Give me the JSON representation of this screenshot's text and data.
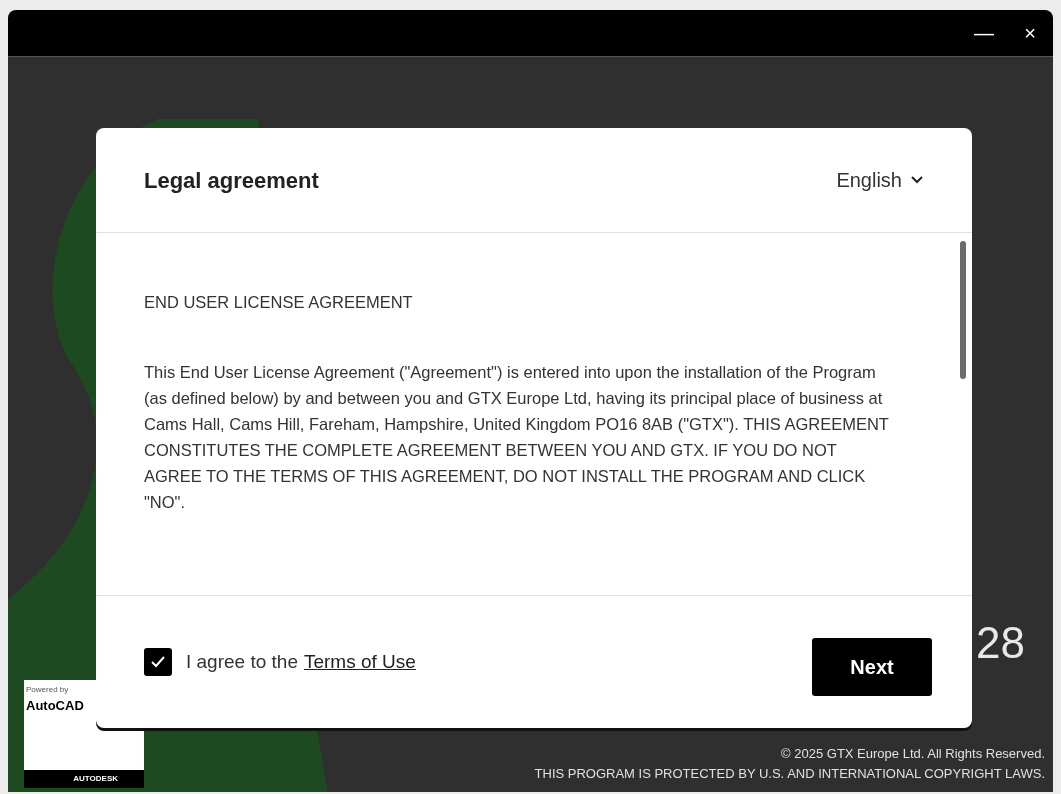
{
  "window": {
    "controls": [
      "—",
      "×"
    ]
  },
  "background": {
    "version_fragment": "28",
    "copyright": "© 2025 GTX Europe Ltd. All Rights Reserved.",
    "legal_notice": "THIS PROGRAM IS PROTECTED BY U.S. AND INTERNATIONAL COPYRIGHT LAWS.",
    "badge": {
      "caption": "Powered by",
      "product": "AutoCAD",
      "vendor": "AUTODESK"
    }
  },
  "dialog": {
    "title": "Legal agreement",
    "language": "English",
    "paragraphs": [
      "END USER LICENSE AGREEMENT",
      "This End User License Agreement (\"Agreement\") is entered into upon the installation of the Program (as defined below) by and between you and GTX Europe Ltd, having its principal place of business at Cams Hall, Cams Hill, Fareham, Hampshire, United Kingdom PO16 8AB (\"GTX\").  THIS AGREEMENT CONSTITUTES THE COMPLETE AGREEMENT BETWEEN YOU AND GTX.  IF YOU DO NOT AGREE TO THE TERMS OF THIS AGREEMENT, DO NOT INSTALL THE PROGRAM AND CLICK \"NO\"."
    ],
    "agree": {
      "checked": true,
      "label": "I agree to the",
      "link": "Terms of Use"
    },
    "next_button": "Next"
  }
}
